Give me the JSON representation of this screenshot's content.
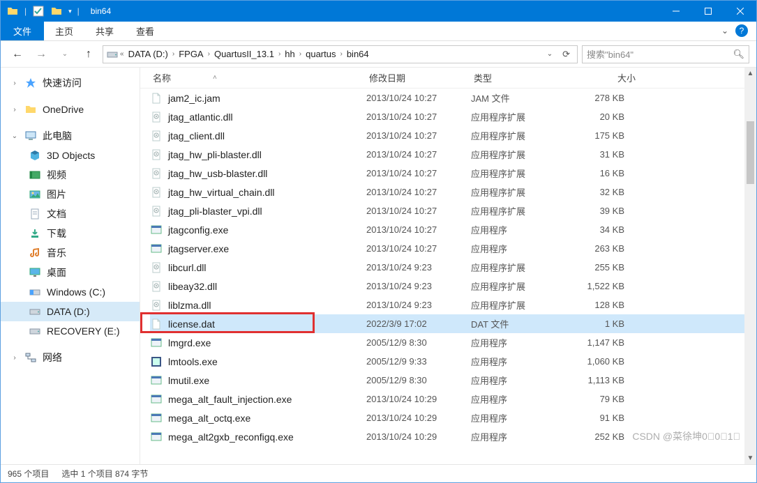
{
  "titlebar": {
    "title": "bin64"
  },
  "ribbon": {
    "file": "文件",
    "tabs": [
      "主页",
      "共享",
      "查看"
    ]
  },
  "breadcrumb": {
    "items": [
      "DATA (D:)",
      "FPGA",
      "QuartusII_13.1",
      "hh",
      "quartus",
      "bin64"
    ]
  },
  "search": {
    "placeholder": "搜索\"bin64\""
  },
  "sidebar": {
    "quick": "快速访问",
    "onedrive": "OneDrive",
    "thispc": "此电脑",
    "pc_children": [
      "3D Objects",
      "视频",
      "图片",
      "文档",
      "下载",
      "音乐",
      "桌面",
      "Windows (C:)",
      "DATA (D:)",
      "RECOVERY (E:)"
    ],
    "network": "网络"
  },
  "columns": {
    "name": "名称",
    "date": "修改日期",
    "type": "类型",
    "size": "大小"
  },
  "files": [
    {
      "icon": "file",
      "name": "jam2_ic.jam",
      "date": "2013/10/24 10:27",
      "type": "JAM 文件",
      "size": "278 KB"
    },
    {
      "icon": "dll",
      "name": "jtag_atlantic.dll",
      "date": "2013/10/24 10:27",
      "type": "应用程序扩展",
      "size": "20 KB"
    },
    {
      "icon": "dll",
      "name": "jtag_client.dll",
      "date": "2013/10/24 10:27",
      "type": "应用程序扩展",
      "size": "175 KB"
    },
    {
      "icon": "dll",
      "name": "jtag_hw_pli-blaster.dll",
      "date": "2013/10/24 10:27",
      "type": "应用程序扩展",
      "size": "31 KB"
    },
    {
      "icon": "dll",
      "name": "jtag_hw_usb-blaster.dll",
      "date": "2013/10/24 10:27",
      "type": "应用程序扩展",
      "size": "16 KB"
    },
    {
      "icon": "dll",
      "name": "jtag_hw_virtual_chain.dll",
      "date": "2013/10/24 10:27",
      "type": "应用程序扩展",
      "size": "32 KB"
    },
    {
      "icon": "dll",
      "name": "jtag_pli-blaster_vpi.dll",
      "date": "2013/10/24 10:27",
      "type": "应用程序扩展",
      "size": "39 KB"
    },
    {
      "icon": "exe",
      "name": "jtagconfig.exe",
      "date": "2013/10/24 10:27",
      "type": "应用程序",
      "size": "34 KB"
    },
    {
      "icon": "exe",
      "name": "jtagserver.exe",
      "date": "2013/10/24 10:27",
      "type": "应用程序",
      "size": "263 KB"
    },
    {
      "icon": "dll",
      "name": "libcurl.dll",
      "date": "2013/10/24 9:23",
      "type": "应用程序扩展",
      "size": "255 KB"
    },
    {
      "icon": "dll",
      "name": "libeay32.dll",
      "date": "2013/10/24 9:23",
      "type": "应用程序扩展",
      "size": "1,522 KB"
    },
    {
      "icon": "dll",
      "name": "liblzma.dll",
      "date": "2013/10/24 9:23",
      "type": "应用程序扩展",
      "size": "128 KB"
    },
    {
      "icon": "file",
      "name": "license.dat",
      "date": "2022/3/9 17:02",
      "type": "DAT 文件",
      "size": "1 KB",
      "selected": true,
      "highlight": true
    },
    {
      "icon": "exe",
      "name": "lmgrd.exe",
      "date": "2005/12/9 8:30",
      "type": "应用程序",
      "size": "1,147 KB"
    },
    {
      "icon": "app",
      "name": "lmtools.exe",
      "date": "2005/12/9 9:33",
      "type": "应用程序",
      "size": "1,060 KB"
    },
    {
      "icon": "exe",
      "name": "lmutil.exe",
      "date": "2005/12/9 8:30",
      "type": "应用程序",
      "size": "1,113 KB"
    },
    {
      "icon": "exe",
      "name": "mega_alt_fault_injection.exe",
      "date": "2013/10/24 10:29",
      "type": "应用程序",
      "size": "79 KB"
    },
    {
      "icon": "exe",
      "name": "mega_alt_octq.exe",
      "date": "2013/10/24 10:29",
      "type": "应用程序",
      "size": "91 KB"
    },
    {
      "icon": "exe",
      "name": "mega_alt2gxb_reconfigq.exe",
      "date": "2013/10/24 10:29",
      "type": "应用程序",
      "size": "252 KB"
    }
  ],
  "status": {
    "count": "965 个项目",
    "selection": "选中 1 个项目 874 字节"
  },
  "watermark": "CSDN @菜徐坤0⃣0⃣1⃣"
}
